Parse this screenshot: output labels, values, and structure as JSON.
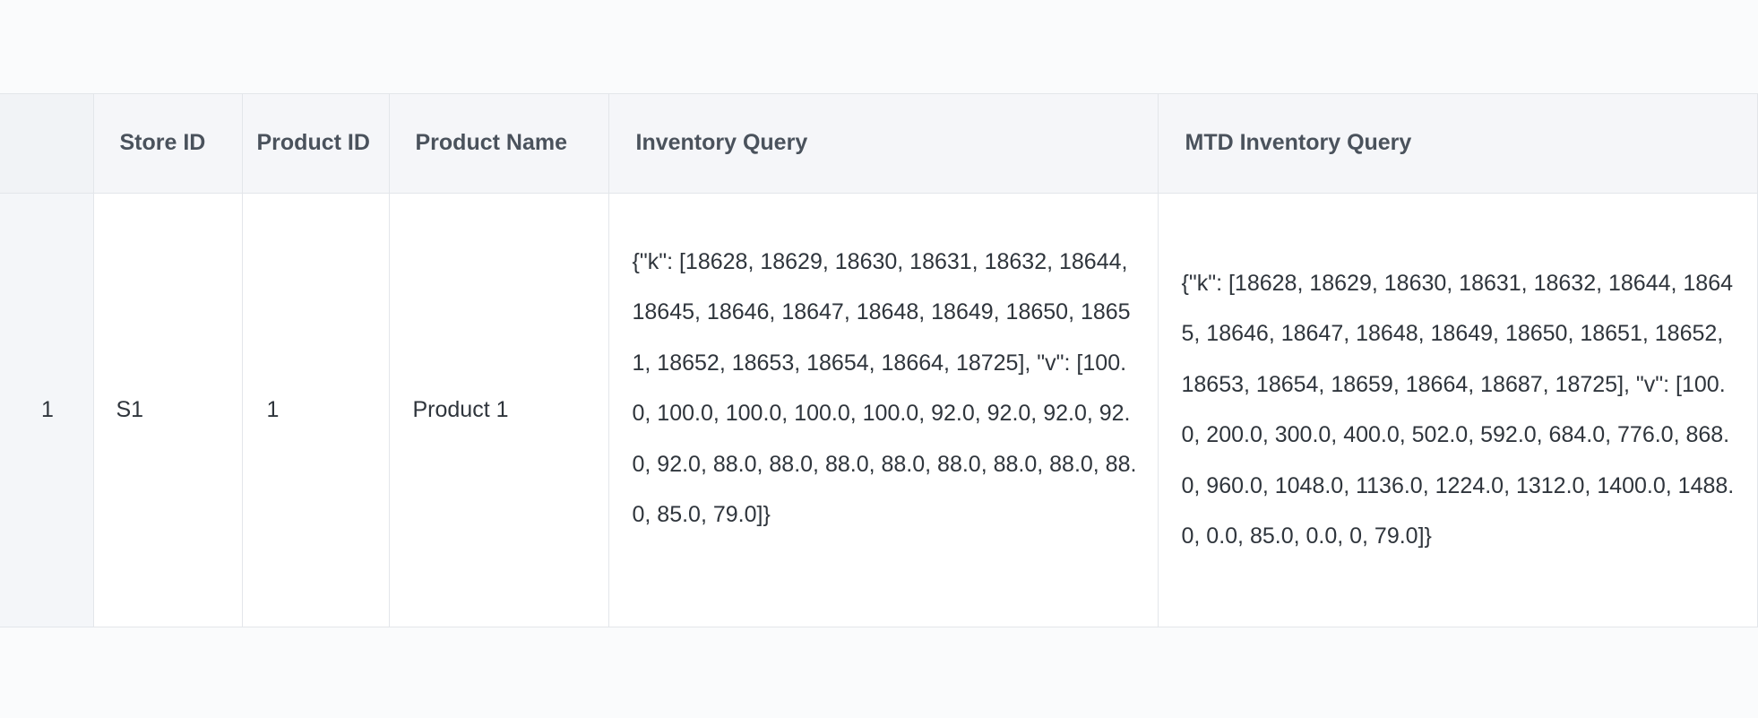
{
  "table": {
    "columns": {
      "index": "",
      "store_id": "Store ID",
      "product_id": "Product ID",
      "product_name": "Product Name",
      "inventory_query": "Inventory Query",
      "mtd_inventory_query": "MTD Inventory Query"
    },
    "rows": [
      {
        "index": "1",
        "store_id": "S1",
        "product_id": "1",
        "product_name": "Product 1",
        "inventory_query": "{\"k\": [18628, 18629, 18630, 18631, 18632, 18644, 18645, 18646, 18647, 18648, 18649, 18650, 18651, 18652, 18653, 18654, 18664, 18725], \"v\": [100.0, 100.0, 100.0, 100.0, 100.0, 92.0, 92.0, 92.0, 92.0, 92.0, 88.0, 88.0, 88.0, 88.0, 88.0, 88.0, 88.0, 88.0, 85.0, 79.0]}",
        "mtd_inventory_query": "{\"k\": [18628, 18629, 18630, 18631, 18632, 18644, 18645, 18646, 18647, 18648, 18649, 18650, 18651, 18652, 18653, 18654, 18659, 18664, 18687, 18725], \"v\": [100.0, 200.0, 300.0, 400.0, 502.0, 592.0, 684.0, 776.0, 868.0, 960.0, 1048.0, 1136.0, 1224.0, 1312.0, 1400.0, 1488.0, 0.0, 85.0, 0.0, 0, 79.0]}"
      }
    ]
  }
}
